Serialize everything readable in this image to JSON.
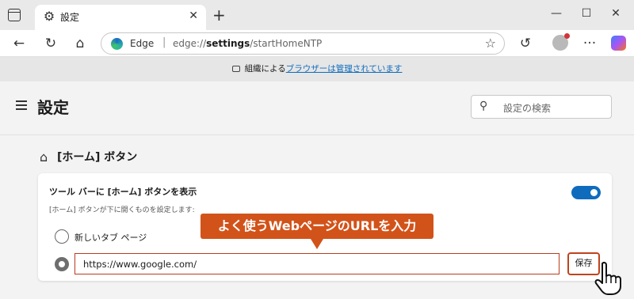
{
  "tab": {
    "title": "設定",
    "icon": "gear-icon"
  },
  "toolbar": {
    "edge_label": "Edge",
    "url_prefix": "edge://",
    "url_bold": "settings",
    "url_suffix": "/startHomeNTP"
  },
  "managed_banner": {
    "text_before": "組織による",
    "link_text": "ブラウザーは管理されています"
  },
  "settings": {
    "page_title": "設定",
    "search_placeholder": "設定の検索"
  },
  "home_section": {
    "title": "[ホーム] ボタン",
    "show_toggle_label": "ツール バーに [ホーム] ボタンを表示",
    "show_toggle_on": true,
    "subtext": "[ホーム] ボタンが下に開くものを設定します:",
    "option_new_tab": "新しいタブ ページ",
    "url_value": "https://www.google.com/",
    "save_label": "保存"
  },
  "annotation": {
    "callout_text": "よく使うWebページのURLを入力"
  },
  "colors": {
    "accent": "#0f6cbd",
    "callout": "#d2531a",
    "highlight_border": "#c0431c"
  }
}
